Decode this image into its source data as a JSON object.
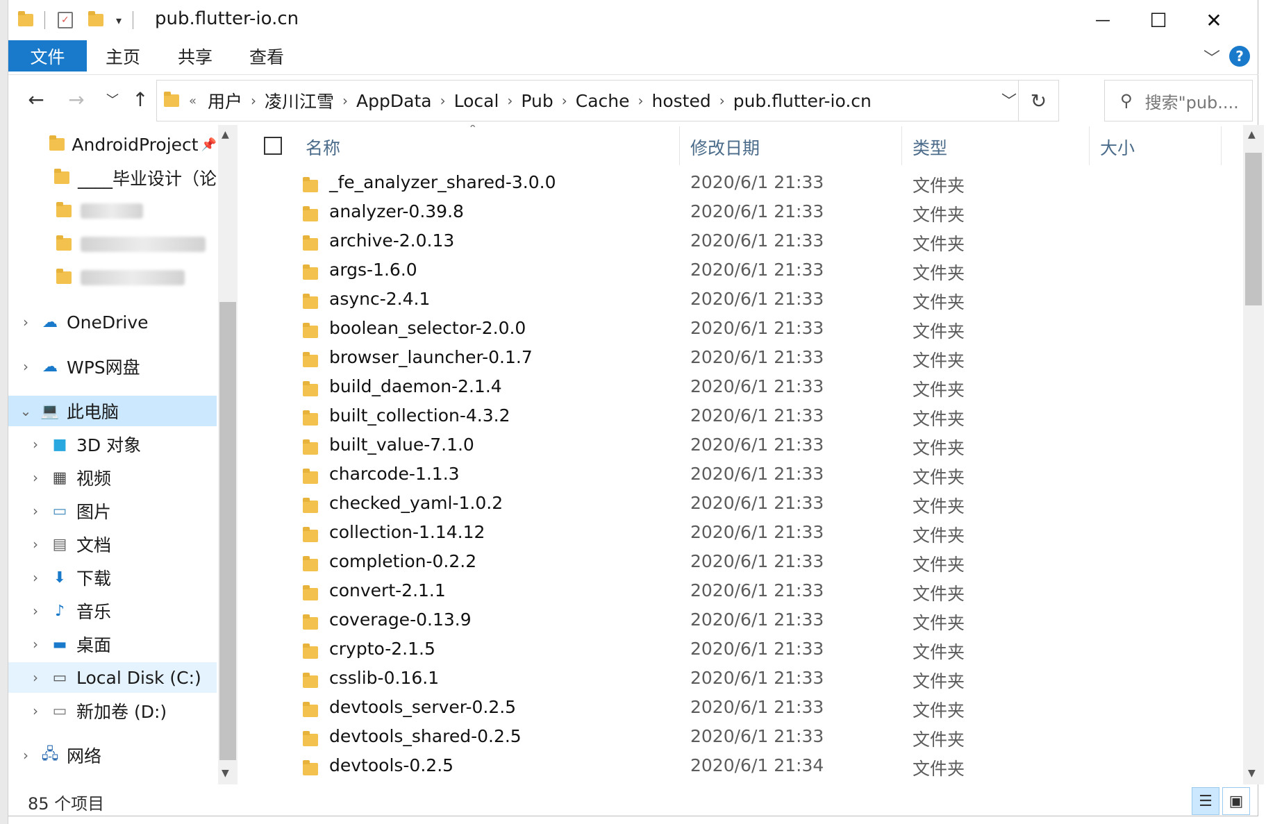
{
  "window": {
    "title": "pub.flutter-io.cn",
    "controls": {
      "minimize": "—",
      "maximize": "☐",
      "close": "✕"
    }
  },
  "ribbon": {
    "file_tab": "文件",
    "tabs": [
      "主页",
      "共享",
      "查看"
    ],
    "help": "?"
  },
  "address": {
    "overflow": "«",
    "crumbs": [
      "用户",
      "凌川江雪",
      "AppData",
      "Local",
      "Pub",
      "Cache",
      "hosted",
      "pub.flutter-io.cn"
    ],
    "search_placeholder": "搜索\"pub...."
  },
  "nav": {
    "items": [
      {
        "label": "AndroidProject",
        "icon": "folder-icon",
        "pinned": true
      },
      {
        "label": "____毕业设计（论",
        "icon": "folder-icon"
      },
      {
        "label": "",
        "icon": "folder-icon",
        "blurred": true
      },
      {
        "label": "",
        "icon": "folder-icon",
        "blurred": true
      },
      {
        "label": "",
        "icon": "folder-icon",
        "blurred": true
      },
      {
        "label": "OneDrive",
        "icon": "cloud-icon"
      },
      {
        "label": "WPS网盘",
        "icon": "cloud-outline-icon"
      },
      {
        "label": "此电脑",
        "icon": "computer-icon"
      },
      {
        "label": "3D 对象",
        "icon": "cube-icon"
      },
      {
        "label": "视频",
        "icon": "film-icon"
      },
      {
        "label": "图片",
        "icon": "picture-icon"
      },
      {
        "label": "文档",
        "icon": "document-icon"
      },
      {
        "label": "下载",
        "icon": "download-icon"
      },
      {
        "label": "音乐",
        "icon": "music-icon"
      },
      {
        "label": "桌面",
        "icon": "desktop-icon"
      },
      {
        "label": "Local Disk (C:)",
        "icon": "drive-c-icon"
      },
      {
        "label": "新加卷 (D:)",
        "icon": "drive-icon"
      },
      {
        "label": "网络",
        "icon": "network-icon"
      }
    ]
  },
  "columns": {
    "name": "名称",
    "date": "修改日期",
    "type": "类型",
    "size": "大小"
  },
  "files": [
    {
      "name": "_fe_analyzer_shared-3.0.0",
      "date": "2020/6/1 21:33",
      "type": "文件夹"
    },
    {
      "name": "analyzer-0.39.8",
      "date": "2020/6/1 21:33",
      "type": "文件夹"
    },
    {
      "name": "archive-2.0.13",
      "date": "2020/6/1 21:33",
      "type": "文件夹"
    },
    {
      "name": "args-1.6.0",
      "date": "2020/6/1 21:33",
      "type": "文件夹"
    },
    {
      "name": "async-2.4.1",
      "date": "2020/6/1 21:33",
      "type": "文件夹"
    },
    {
      "name": "boolean_selector-2.0.0",
      "date": "2020/6/1 21:33",
      "type": "文件夹"
    },
    {
      "name": "browser_launcher-0.1.7",
      "date": "2020/6/1 21:33",
      "type": "文件夹"
    },
    {
      "name": "build_daemon-2.1.4",
      "date": "2020/6/1 21:33",
      "type": "文件夹"
    },
    {
      "name": "built_collection-4.3.2",
      "date": "2020/6/1 21:33",
      "type": "文件夹"
    },
    {
      "name": "built_value-7.1.0",
      "date": "2020/6/1 21:33",
      "type": "文件夹"
    },
    {
      "name": "charcode-1.1.3",
      "date": "2020/6/1 21:33",
      "type": "文件夹"
    },
    {
      "name": "checked_yaml-1.0.2",
      "date": "2020/6/1 21:33",
      "type": "文件夹"
    },
    {
      "name": "collection-1.14.12",
      "date": "2020/6/1 21:33",
      "type": "文件夹"
    },
    {
      "name": "completion-0.2.2",
      "date": "2020/6/1 21:33",
      "type": "文件夹"
    },
    {
      "name": "convert-2.1.1",
      "date": "2020/6/1 21:33",
      "type": "文件夹"
    },
    {
      "name": "coverage-0.13.9",
      "date": "2020/6/1 21:33",
      "type": "文件夹"
    },
    {
      "name": "crypto-2.1.5",
      "date": "2020/6/1 21:33",
      "type": "文件夹"
    },
    {
      "name": "csslib-0.16.1",
      "date": "2020/6/1 21:33",
      "type": "文件夹"
    },
    {
      "name": "devtools_server-0.2.5",
      "date": "2020/6/1 21:33",
      "type": "文件夹"
    },
    {
      "name": "devtools_shared-0.2.5",
      "date": "2020/6/1 21:33",
      "type": "文件夹"
    },
    {
      "name": "devtools-0.2.5",
      "date": "2020/6/1 21:34",
      "type": "文件夹"
    }
  ],
  "status": {
    "item_count": "85 个项目"
  },
  "colors": {
    "accent": "#1979ca",
    "selected": "#cce8ff",
    "folder": "#f2c14e"
  }
}
